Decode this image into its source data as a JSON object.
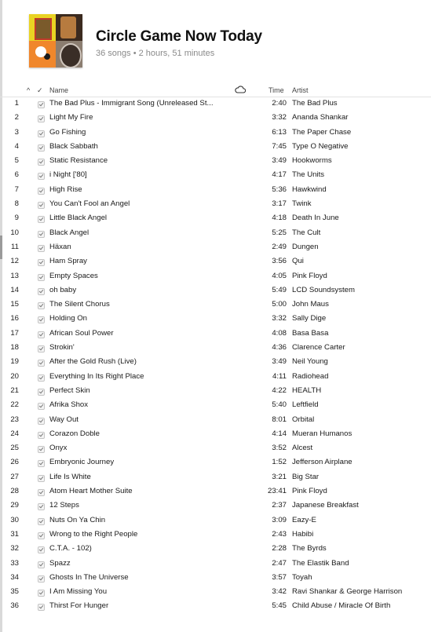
{
  "playlist": {
    "title": "Circle Game Now Today",
    "subtitle": "36 songs • 2 hours, 51 minutes"
  },
  "columns": {
    "sort": "^",
    "check": "✓",
    "name": "Name",
    "cloud": "cloud-icon",
    "time": "Time",
    "artist": "Artist"
  },
  "tracks": [
    {
      "n": "1",
      "name": "The Bad Plus - Immigrant Song (Unreleased St...",
      "time": "2:40",
      "artist": "The Bad Plus"
    },
    {
      "n": "2",
      "name": "Light My Fire",
      "time": "3:32",
      "artist": "Ananda Shankar"
    },
    {
      "n": "3",
      "name": "Go Fishing",
      "time": "6:13",
      "artist": "The Paper Chase"
    },
    {
      "n": "4",
      "name": "Black Sabbath",
      "time": "7:45",
      "artist": "Type O Negative"
    },
    {
      "n": "5",
      "name": "Static Resistance",
      "time": "3:49",
      "artist": "Hookworms"
    },
    {
      "n": "6",
      "name": "i Night ['80]",
      "time": "4:17",
      "artist": "The Units"
    },
    {
      "n": "7",
      "name": "High Rise",
      "time": "5:36",
      "artist": "Hawkwind"
    },
    {
      "n": "8",
      "name": "You Can't Fool an Angel",
      "time": "3:17",
      "artist": "Twink"
    },
    {
      "n": "9",
      "name": "Little Black Angel",
      "time": "4:18",
      "artist": "Death In June"
    },
    {
      "n": "10",
      "name": "Black Angel",
      "time": "5:25",
      "artist": "The Cult"
    },
    {
      "n": "11",
      "name": "Häxan",
      "time": "2:49",
      "artist": "Dungen"
    },
    {
      "n": "12",
      "name": "Ham Spray",
      "time": "3:56",
      "artist": "Qui"
    },
    {
      "n": "13",
      "name": "Empty Spaces",
      "time": "4:05",
      "artist": "Pink Floyd"
    },
    {
      "n": "14",
      "name": "oh baby",
      "time": "5:49",
      "artist": "LCD Soundsystem"
    },
    {
      "n": "15",
      "name": "The Silent Chorus",
      "time": "5:00",
      "artist": "John Maus"
    },
    {
      "n": "16",
      "name": "Holding On",
      "time": "3:32",
      "artist": "Sally Dige"
    },
    {
      "n": "17",
      "name": "African Soul Power",
      "time": "4:08",
      "artist": "Basa Basa"
    },
    {
      "n": "18",
      "name": "Strokin'",
      "time": "4:36",
      "artist": "Clarence Carter"
    },
    {
      "n": "19",
      "name": "After the Gold Rush (Live)",
      "time": "3:49",
      "artist": "Neil Young"
    },
    {
      "n": "20",
      "name": "Everything In Its Right Place",
      "time": "4:11",
      "artist": "Radiohead"
    },
    {
      "n": "21",
      "name": "Perfect Skin",
      "time": "4:22",
      "artist": "HEALTH"
    },
    {
      "n": "22",
      "name": "Afrika Shox",
      "time": "5:40",
      "artist": "Leftfield"
    },
    {
      "n": "23",
      "name": "Way Out",
      "time": "8:01",
      "artist": "Orbital"
    },
    {
      "n": "24",
      "name": "Corazon Doble",
      "time": "4:14",
      "artist": "Mueran Humanos"
    },
    {
      "n": "25",
      "name": "Onyx",
      "time": "3:52",
      "artist": "Alcest"
    },
    {
      "n": "26",
      "name": "Embryonic Journey",
      "time": "1:52",
      "artist": "Jefferson Airplane"
    },
    {
      "n": "27",
      "name": "Life Is White",
      "time": "3:21",
      "artist": "Big Star"
    },
    {
      "n": "28",
      "name": "Atom Heart Mother Suite",
      "time": "23:41",
      "artist": "Pink Floyd"
    },
    {
      "n": "29",
      "name": "12 Steps",
      "time": "2:37",
      "artist": "Japanese Breakfast"
    },
    {
      "n": "30",
      "name": "Nuts On Ya Chin",
      "time": "3:09",
      "artist": "Eazy-E"
    },
    {
      "n": "31",
      "name": "Wrong to the Right People",
      "time": "2:43",
      "artist": "Habibi"
    },
    {
      "n": "32",
      "name": "C.T.A. - 102)",
      "time": "2:28",
      "artist": "The Byrds"
    },
    {
      "n": "33",
      "name": "Spazz",
      "time": "2:47",
      "artist": "The Elastik Band"
    },
    {
      "n": "34",
      "name": "Ghosts In The Universe",
      "time": "3:57",
      "artist": "Toyah"
    },
    {
      "n": "35",
      "name": "I Am Missing You",
      "time": "3:42",
      "artist": "Ravi Shankar & George Harrison"
    },
    {
      "n": "36",
      "name": "Thirst For Hunger",
      "time": "5:45",
      "artist": "Child Abuse / Miracle Of Birth"
    }
  ]
}
